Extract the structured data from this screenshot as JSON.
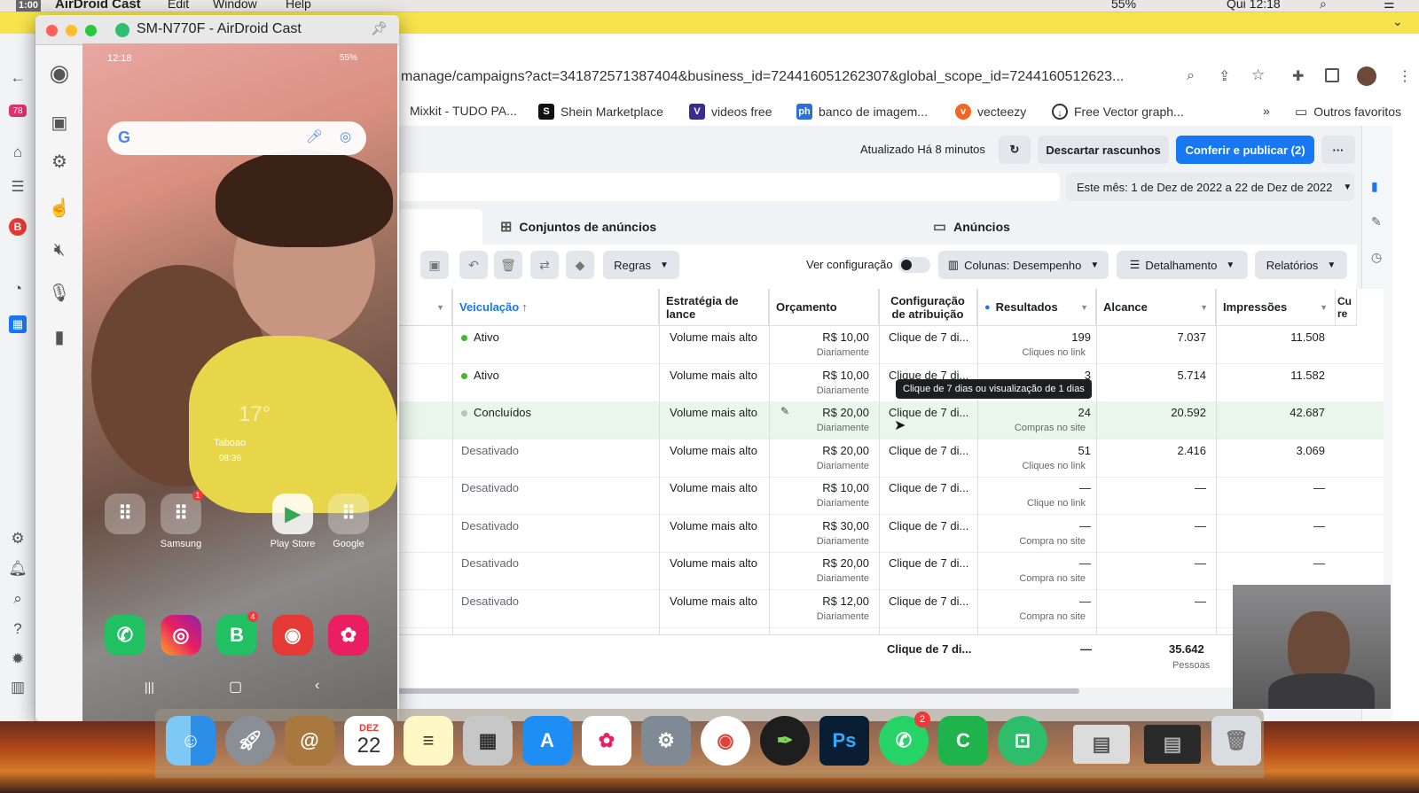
{
  "macos_menu": {
    "app_name": "AirDroid Cast",
    "items": [
      "Edit",
      "Window",
      "Help"
    ],
    "timer": "1:00",
    "battery": "55%",
    "time": "Qui 12:18"
  },
  "airdroid": {
    "title": "SM-N770F - AirDroid Cast"
  },
  "phone": {
    "status_time": "12:18",
    "battery": "55%",
    "weather_temp": "17°",
    "location": "Taboao",
    "loc_time": "08:36",
    "apps": {
      "samsung": "Samsung",
      "play_store": "Play Store",
      "google": "Google"
    },
    "badges": {
      "samsung": "1",
      "whatsapp_business": "4"
    }
  },
  "chrome": {
    "url": "manage/campaigns?act=341872571387404&business_id=724416051262307&global_scope_id=7244160512623...",
    "bookmarks": [
      "Mixkit - TUDO PA...",
      "Shein Marketplace",
      "videos free",
      "banco de imagem...",
      "vecteezy",
      "Free Vector graph..."
    ],
    "bookmarks_more": "»",
    "other_bookmarks": "Outros favoritos",
    "side_badge": "78"
  },
  "ads": {
    "updated": "Atualizado Há 8 minutos",
    "discard": "Descartar rascunhos",
    "publish": "Conferir e publicar (2)",
    "more": "···",
    "date_range": "Este mês: 1 de Dez de 2022 a 22 de Dez de 2022",
    "tab_adsets": "Conjuntos de anúncios",
    "tab_ads": "Anúncios",
    "rules": "Regras",
    "view_config": "Ver configuração",
    "columns": "Colunas: Desempenho",
    "breakdown": "Detalhamento",
    "reports": "Relatórios",
    "headers": {
      "delivery": "Veiculação",
      "bid": "Estratégia de lance",
      "budget": "Orçamento",
      "attribution": "Configuração de atribuição",
      "results": "Resultados",
      "reach": "Alcance",
      "impressions": "Impressões",
      "cut": "Cu re"
    },
    "rows": [
      {
        "delivery": "Ativo",
        "bid": "Volume mais alto",
        "budget": "R$ 10,00",
        "budget_sub": "Diariamente",
        "attribution": "Clique de 7 di...",
        "results": "199",
        "results_sub": "Cliques no link",
        "reach": "7.037",
        "impressions": "11.508",
        "status": "green"
      },
      {
        "delivery": "Ativo",
        "bid": "Volume mais alto",
        "budget": "R$ 10,00",
        "budget_sub": "Diariamente",
        "attribution": "Clique de 7 di...",
        "results": "3",
        "results_sub": "",
        "reach": "5.714",
        "impressions": "11.582",
        "status": "green"
      },
      {
        "delivery": "Concluídos",
        "bid": "Volume mais alto",
        "budget": "R$ 20,00",
        "budget_sub": "Diariamente",
        "attribution": "Clique de 7 di...",
        "results": "24",
        "results_sub": "Compras no site",
        "reach": "20.592",
        "impressions": "42.687",
        "status": "gray"
      },
      {
        "delivery": "Desativado",
        "bid": "Volume mais alto",
        "budget": "R$ 20,00",
        "budget_sub": "Diariamente",
        "attribution": "Clique de 7 di...",
        "results": "51",
        "results_sub": "Cliques no link",
        "reach": "2.416",
        "impressions": "3.069",
        "status": "none"
      },
      {
        "delivery": "Desativado",
        "bid": "Volume mais alto",
        "budget": "R$ 10,00",
        "budget_sub": "Diariamente",
        "attribution": "Clique de 7 di...",
        "results": "—",
        "results_sub": "Clique no link",
        "reach": "—",
        "impressions": "—",
        "status": "none"
      },
      {
        "delivery": "Desativado",
        "bid": "Volume mais alto",
        "budget": "R$ 30,00",
        "budget_sub": "Diariamente",
        "attribution": "Clique de 7 di...",
        "results": "—",
        "results_sub": "Compra no site",
        "reach": "—",
        "impressions": "—",
        "status": "none"
      },
      {
        "delivery": "Desativado",
        "bid": "Volume mais alto",
        "budget": "R$ 20,00",
        "budget_sub": "Diariamente",
        "attribution": "Clique de 7 di...",
        "results": "—",
        "results_sub": "Compra no site",
        "reach": "—",
        "impressions": "—",
        "status": "none"
      },
      {
        "delivery": "Desativado",
        "bid": "Volume mais alto",
        "budget": "R$ 12,00",
        "budget_sub": "Diariamente",
        "attribution": "Clique de 7 di...",
        "results": "—",
        "results_sub": "Compra no site",
        "reach": "—",
        "impressions": "",
        "status": "none"
      }
    ],
    "total": {
      "attribution": "Clique de 7 di...",
      "results": "—",
      "reach": "35.642",
      "reach_sub": "Pessoas"
    },
    "tooltip": "Clique de 7 dias ou visualização de 1 dias"
  },
  "dock": {
    "calendar_month": "DEZ",
    "calendar_day": "22",
    "whatsapp_badge": "2"
  }
}
